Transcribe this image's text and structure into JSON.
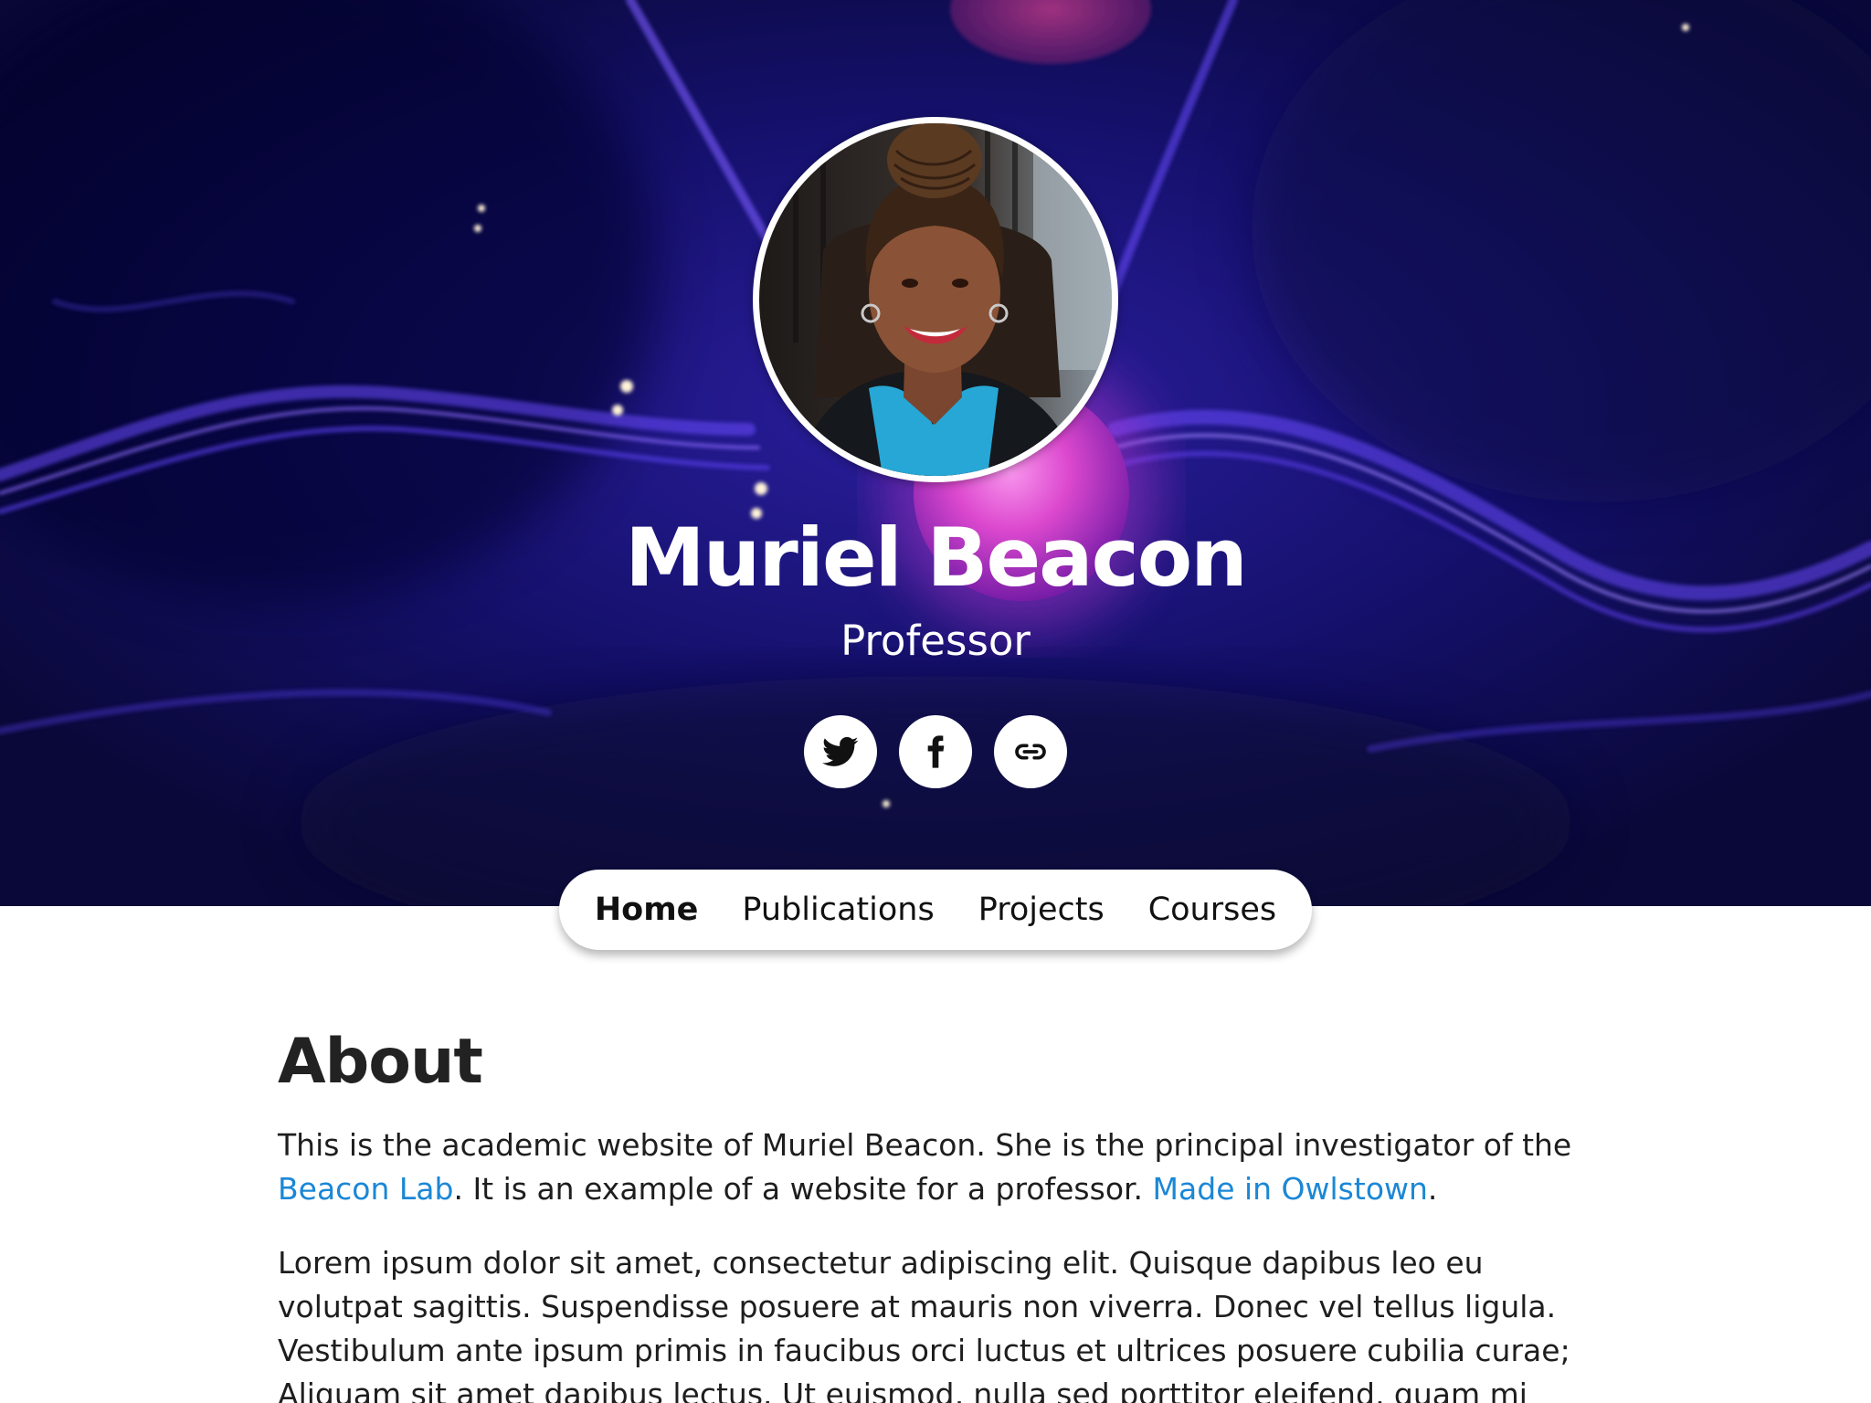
{
  "profile": {
    "name": "Muriel Beacon",
    "role": "Professor"
  },
  "social": [
    {
      "icon": "twitter-icon"
    },
    {
      "icon": "facebook-icon"
    },
    {
      "icon": "link-icon"
    }
  ],
  "nav": {
    "items": [
      {
        "label": "Home",
        "active": true
      },
      {
        "label": "Publications",
        "active": false
      },
      {
        "label": "Projects",
        "active": false
      },
      {
        "label": "Courses",
        "active": false
      }
    ]
  },
  "about": {
    "title": "About",
    "intro_1": "This is the academic website of Muriel Beacon. She is the principal investigator of the",
    "lab_link": "Beacon Lab",
    "intro_2": ". It is an example of a website for a professor.",
    "owlstown_link": "Made in Owlstown",
    "intro_3": ".",
    "lorem": "Lorem ipsum dolor sit amet, consectetur adipiscing elit. Quisque dapibus leo eu volutpat sagittis. Suspendisse posuere at mauris non viverra. Donec vel tellus ligula. Vestibulum ante ipsum primis in faucibus orci luctus et ultrices posuere cubilia curae; Aliquam sit amet dapibus lectus. Ut euismod, nulla sed porttitor eleifend, quam mi"
  },
  "colors": {
    "link": "#1b87d6",
    "hero_background": "#0b0a3a",
    "text": "#1e1e1e"
  }
}
